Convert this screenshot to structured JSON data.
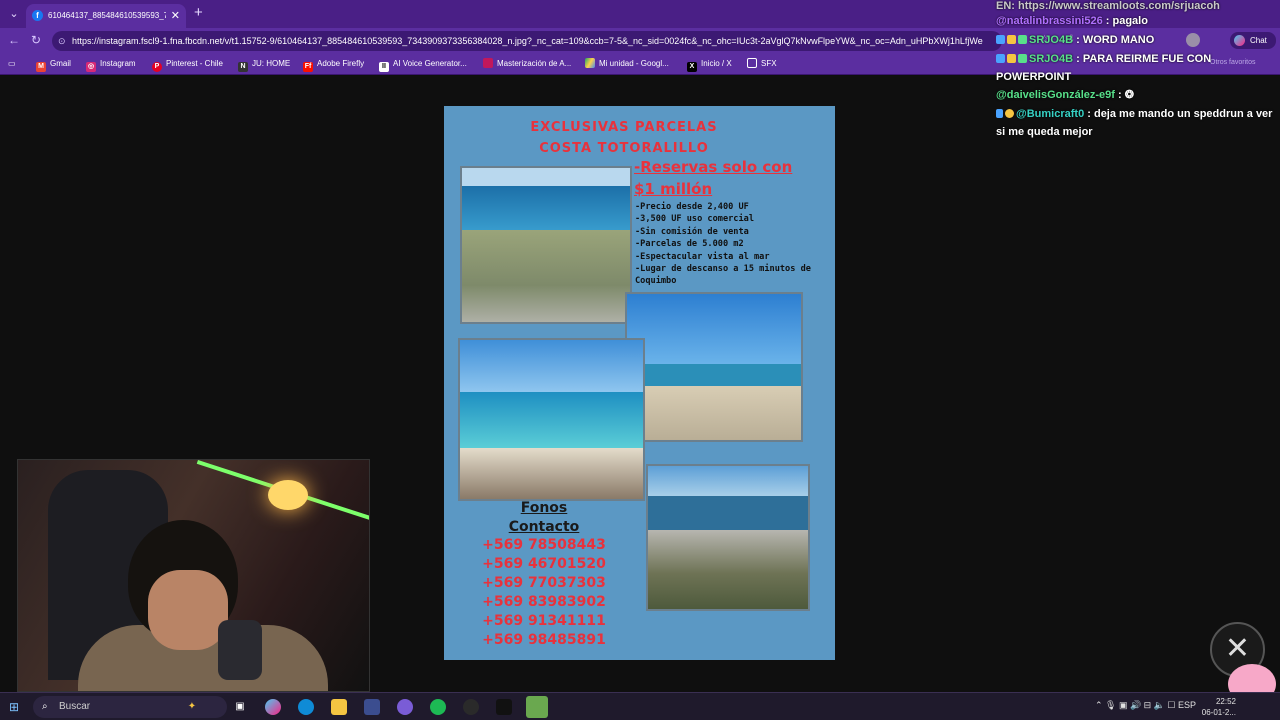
{
  "browser": {
    "tab_title": "610464137_885484610539593_73...",
    "close_glyph": "✕",
    "new_tab_glyph": "+",
    "url": "https://instagram.fscl9-1.fna.fbcdn.net/v/t1.15752-9/610464137_885484610539593_7343909373356384028_n.jpg?_nc_cat=109&ccb=7-5&_nc_sid=0024fc&_nc_ohc=IUc3t-2aVglQ7kNvwFlpeYW&_nc_oc=Adn_uHPbXWj1hLfjWe",
    "chat_label": "Chat",
    "bookmarks_more": "Otros favoritos",
    "bookmarks": [
      {
        "label": "Gmail",
        "color": "#ea4335"
      },
      {
        "label": "Instagram",
        "color": "#d62976"
      },
      {
        "label": "Pinterest - Chile",
        "color": "#e60023"
      },
      {
        "label": "JU: HOME",
        "color": "#333333"
      },
      {
        "label": "Adobe Firefly",
        "color": "#fa0f00"
      },
      {
        "label": "AI Voice Generator...",
        "color": "#111111"
      },
      {
        "label": "Masterización de A...",
        "color": "#c2185b"
      },
      {
        "label": "Mi unidad - Googl...",
        "color": "#1fa463"
      },
      {
        "label": "Inicio / X",
        "color": "#000000"
      },
      {
        "label": "SFX",
        "color": "#5b2ea0"
      }
    ]
  },
  "poster": {
    "title_line1": "EXCLUSIVAS PARCELAS",
    "title_line2": "COSTA TOTORALILLO",
    "reserve_line1": "-Reservas solo con",
    "reserve_line2": "$1 millón",
    "features": [
      "-Precio desde 2,400 UF",
      "-3,500 UF uso comercial",
      "-Sin comisión de venta",
      "-Parcelas de 5.000 m2",
      "-Espectacular vista al mar",
      "-Lugar de descanso a 15 minutos de",
      "Coquimbo"
    ],
    "contact_heading1": "Fonos",
    "contact_heading2": "Contacto",
    "phones": [
      "+569 78508443",
      "+569 46701520",
      "+569 77037303",
      "+569 83983902",
      "+569 91341111",
      "+569 98485891"
    ]
  },
  "chat": {
    "line0": "EN: https://www.streamloots.com/srjuacoh",
    "messages": [
      {
        "user": "@natalinbrassini526",
        "text": ": pagalo"
      },
      {
        "user": "SRJO4B",
        "text": ": WORD MANO"
      },
      {
        "user": "SRJO4B",
        "text": ": PARA REIRME FUE CON POWERPOINT"
      },
      {
        "user": "@daivelisGonzález-e9f",
        "text": ":"
      },
      {
        "user": "@Bumicraft0",
        "text": ": deja me mando un speddrun a ver si me queda mejor"
      }
    ]
  },
  "taskbar": {
    "search_placeholder": "Buscar",
    "language": "ESP",
    "time": "22:52",
    "date": "06-01-2..."
  },
  "colors": {
    "chrome": "#5b2ea0",
    "poster_bg": "#5b98c4",
    "poster_red": "#e8323c"
  }
}
